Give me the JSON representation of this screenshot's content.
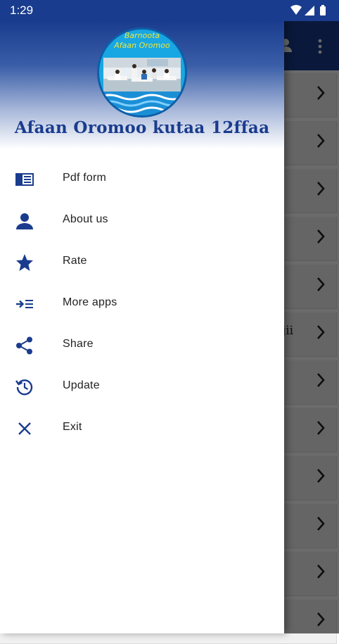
{
  "status_bar": {
    "time": "1:29"
  },
  "drawer": {
    "logo": {
      "line1": "Barnoota",
      "line2": "Afaan Oromoo"
    },
    "title": "Afaan Oromoo kutaa 12ffaa",
    "items": [
      {
        "label": "Pdf form",
        "icon": "pdf-form-icon"
      },
      {
        "label": "About us",
        "icon": "person-icon"
      },
      {
        "label": "Rate",
        "icon": "star-icon"
      },
      {
        "label": "More apps",
        "icon": "more-apps-icon"
      },
      {
        "label": "Share",
        "icon": "share-icon"
      },
      {
        "label": "Update",
        "icon": "update-icon"
      },
      {
        "label": "Exit",
        "icon": "close-icon"
      }
    ]
  },
  "background": {
    "row_fragment": "ujii"
  },
  "colors": {
    "primary": "#1a3c8e",
    "icon": "#1a3c8e",
    "text": "#222222"
  }
}
